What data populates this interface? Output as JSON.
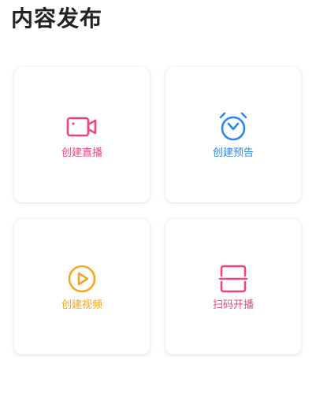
{
  "header": {
    "title": "内容发布"
  },
  "cards": [
    {
      "label": "创建直播",
      "icon": "video-camera-icon",
      "color": "#f0457a"
    },
    {
      "label": "创建预告",
      "icon": "alarm-clock-icon",
      "color": "#2a8ae8"
    },
    {
      "label": "创建视频",
      "icon": "play-circle-icon",
      "color": "#f5a623"
    },
    {
      "label": "扫码开播",
      "icon": "scan-icon",
      "color": "#f0457a"
    }
  ]
}
